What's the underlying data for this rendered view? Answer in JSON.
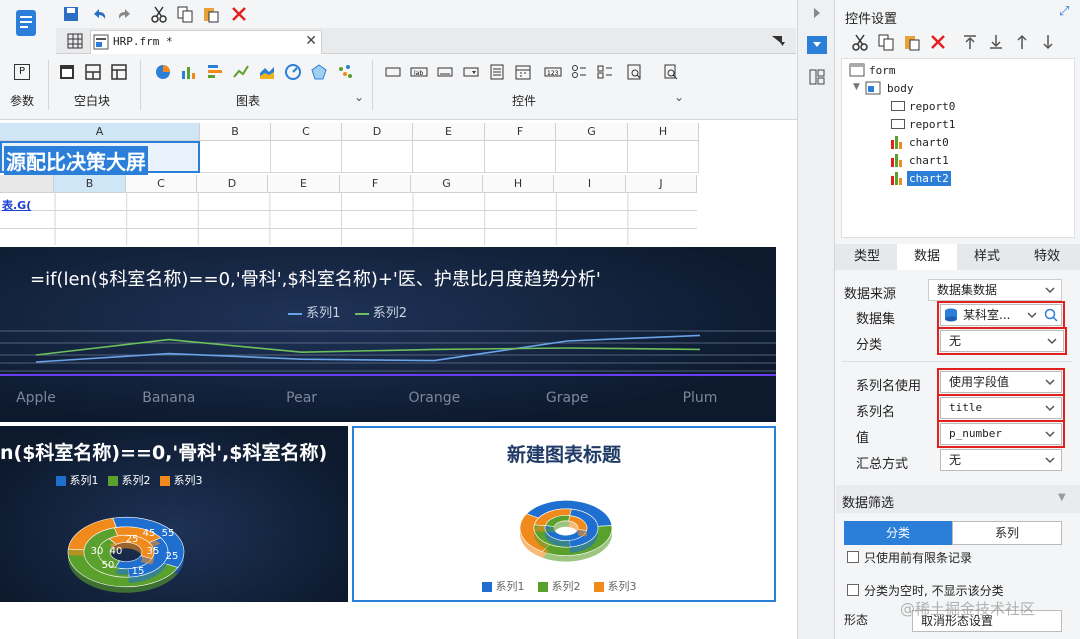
{
  "toolbar": {
    "sections": [
      "参数",
      "空白块",
      "图表",
      "控件"
    ],
    "tab_title": "HRP.frm *",
    "param_icon": "P"
  },
  "sheet": {
    "col_headers_top": [
      "A",
      "B",
      "C",
      "D",
      "E",
      "F",
      "G",
      "H"
    ],
    "col_headers_sub": [
      "B",
      "C",
      "D",
      "E",
      "F",
      "G",
      "H",
      "I",
      "J"
    ],
    "title_cell": "源配比决策大屏",
    "link_cell": "表.G("
  },
  "chart_line": {
    "title": "=if(len($科室名称)==0,'骨科',$科室名称)+'医、护患比月度趋势分析'",
    "legend": [
      "系列1",
      "系列2"
    ],
    "categories": [
      "Apple",
      "Banana",
      "Pear",
      "Orange",
      "Grape",
      "Plum"
    ]
  },
  "chart_pie_left": {
    "title": "n($科室名称)==0,'骨科',$科室名称)",
    "legend": [
      "系列1",
      "系列2",
      "系列3"
    ],
    "labels": [
      "30",
      "40",
      "50",
      "25",
      "45",
      "55",
      "35",
      "25",
      "15"
    ]
  },
  "chart_pie_right": {
    "title": "新建图表标题",
    "legend": [
      "系列1",
      "系列2",
      "系列3"
    ]
  },
  "chart_data": [
    {
      "type": "line",
      "title": "=if(len($科室名称)==0,'骨科',$科室名称)+'医、护患比月度趋势分析'",
      "categories": [
        "Apple",
        "Banana",
        "Pear",
        "Orange",
        "Grape",
        "Plum"
      ],
      "series": [
        {
          "name": "系列1",
          "values": [
            10,
            22,
            14,
            12,
            40,
            48
          ]
        },
        {
          "name": "系列2",
          "values": [
            20,
            42,
            24,
            28,
            30,
            28
          ]
        }
      ],
      "legend": "top-center"
    },
    {
      "type": "pie",
      "title": "n($科室名称)==0,'骨科',$科室名称)",
      "series": [
        {
          "name": "系列1",
          "values": [
            30,
            40,
            50
          ]
        },
        {
          "name": "系列2",
          "values": [
            25,
            35,
            15
          ]
        },
        {
          "name": "系列3",
          "values": [
            45,
            55,
            25
          ]
        }
      ]
    },
    {
      "type": "pie",
      "title": "新建图表标题",
      "series": [
        {
          "name": "系列1"
        },
        {
          "name": "系列2"
        },
        {
          "name": "系列3"
        }
      ]
    }
  ],
  "panel": {
    "title": "控件设置",
    "tree": [
      "form",
      "body",
      "report0",
      "report1",
      "chart0",
      "chart1",
      "chart2"
    ],
    "tabs": [
      "类型",
      "数据",
      "样式",
      "特效"
    ],
    "rows": {
      "data_source_label": "数据来源",
      "data_source_value": "数据集数据",
      "dataset_label": "数据集",
      "dataset_value": "某科室...",
      "category_label": "分类",
      "category_value": "无",
      "series_name_use_label": "系列名使用",
      "series_name_use_value": "使用字段值",
      "series_name_label": "系列名",
      "series_name_value": "title",
      "value_label": "值",
      "value_value": "p_number",
      "summary_label": "汇总方式",
      "summary_value": "无"
    },
    "filter_title": "数据筛选",
    "filter_tabs": [
      "分类",
      "系列"
    ],
    "chk1": "只使用前有限条记录",
    "chk2": "分类为空时, 不显示该分类",
    "shape_label": "形态",
    "shape_value": "取消形态设置"
  },
  "watermark": "@稀土掘金技术社区",
  "colors": {
    "accent": "#2b7fd9",
    "red": "#e0211d",
    "series1": "#1f6fd0",
    "series2": "#5aa02c",
    "series3": "#f08a1c",
    "dark": "#0d1a2e"
  }
}
